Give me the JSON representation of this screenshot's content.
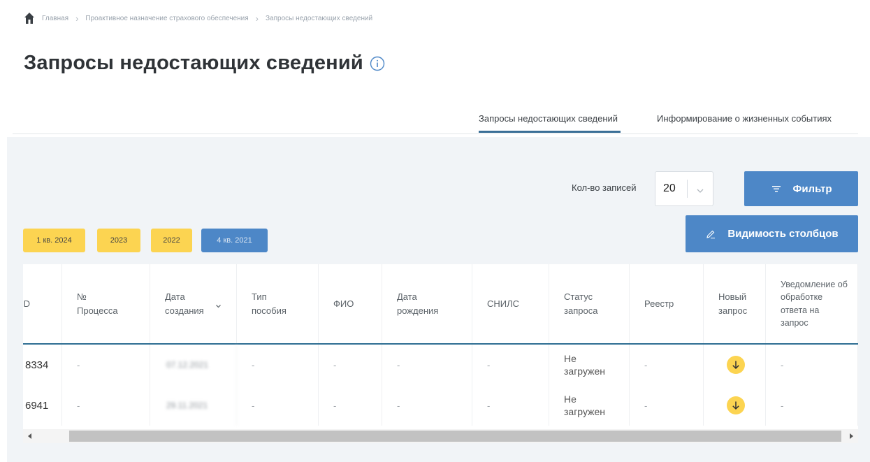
{
  "breadcrumb": {
    "items": [
      "Главная",
      "Проактивное назначение страхового обеспечения",
      "Запросы недостающих сведений"
    ]
  },
  "page": {
    "title": "Запросы недостающих сведений"
  },
  "tabs": [
    {
      "label": "Запросы недостающих сведений",
      "active": true
    },
    {
      "label": "Информирование о жизненных событиях",
      "active": false
    }
  ],
  "controls": {
    "records_label": "Кол-во записей",
    "records_value": "20",
    "filter_label": "Фильтр",
    "columns_label": "Видимость столбцов"
  },
  "periods": [
    {
      "label": "1 кв. 2024",
      "selected": false
    },
    {
      "label": "2023",
      "selected": false
    },
    {
      "label": "2022",
      "selected": false
    },
    {
      "label": "4 кв. 2021",
      "selected": true
    }
  ],
  "table": {
    "columns": [
      "ID",
      "№ Процесса",
      "Дата создания",
      "Тип пособия",
      "ФИО",
      "Дата рождения",
      "СНИЛС",
      "Статус запроса",
      "Реестр",
      "Новый запрос",
      "Уведомление об обработке ответа на запрос"
    ],
    "rows": [
      {
        "id": "8334",
        "process": "-",
        "created": "07.12.2021",
        "type": "-",
        "fio": "-",
        "birth": "-",
        "snils": "-",
        "status": "Не загружен",
        "registry": "-",
        "notice": "-"
      },
      {
        "id": "6941",
        "process": "-",
        "created": "29.11.2021",
        "type": "-",
        "fio": "-",
        "birth": "-",
        "snils": "-",
        "status": "Не загружен",
        "registry": "-",
        "notice": "-"
      }
    ]
  },
  "colors": {
    "accent_blue": "#4d87c7",
    "chip_yellow": "#fcd451",
    "header_rule": "#2f6f93",
    "panel_bg": "#f1f4f7"
  },
  "icons": [
    "home-icon",
    "info-icon",
    "chevron-down-icon",
    "filter-icon",
    "pencil-icon",
    "sort-icon",
    "download-arrow-icon",
    "scroll-left-icon",
    "scroll-right-icon"
  ]
}
